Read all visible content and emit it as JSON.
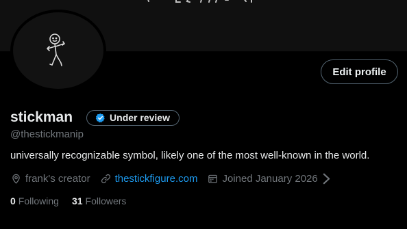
{
  "profile": {
    "display_name": "stickman",
    "badge_label": "Under review",
    "handle": "@thestickmanip",
    "bio": "universally recognizable symbol, likely one of the most well-known in the world.",
    "edit_profile_label": "Edit profile",
    "location": "frank's creator",
    "website": "thestickfigure.com",
    "joined": "Joined January 2026",
    "following_count": "0",
    "following_label": "Following",
    "followers_count": "31",
    "followers_label": "Followers"
  },
  "icons": {
    "badge": "verified-check-icon",
    "location": "location-pin-icon",
    "website": "link-icon",
    "joined": "calendar-icon",
    "joined_more": "chevron-right-icon"
  },
  "colors": {
    "background": "#000000",
    "banner": "#101010",
    "primary_text": "#e7e9ea",
    "secondary_text": "#71767b",
    "link": "#1d9bf0",
    "border": "#536471"
  }
}
